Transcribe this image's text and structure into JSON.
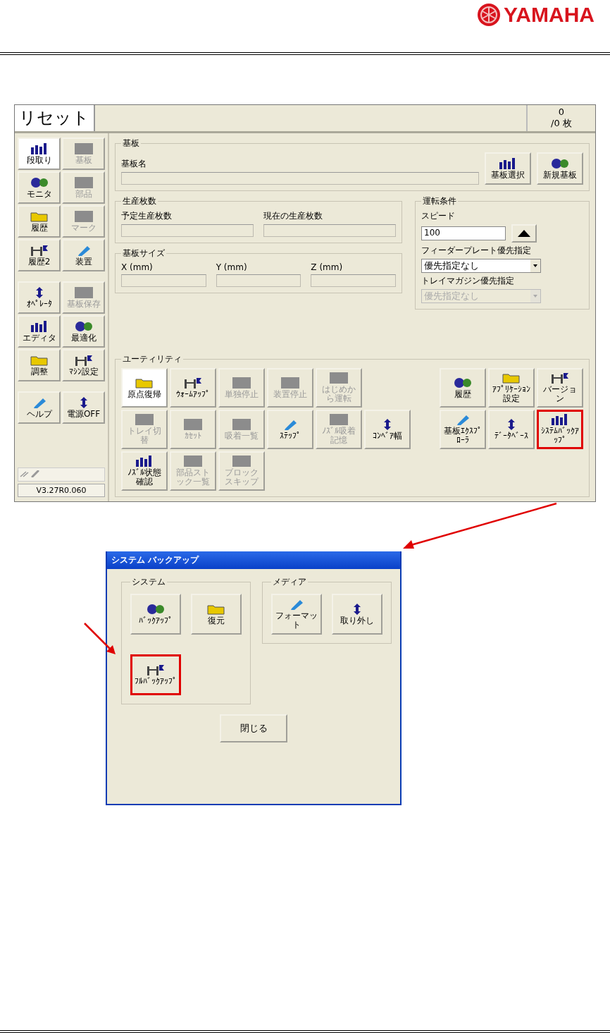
{
  "header": {
    "logo_text": "YAMAHA"
  },
  "main_window": {
    "title": "リセット",
    "count": "0",
    "count_total": "/0 枚",
    "side_groups": [
      [
        {
          "label": "段取り",
          "selected": true,
          "disabled": false
        },
        {
          "label": "基板",
          "selected": false,
          "disabled": true
        },
        {
          "label": "モニタ",
          "selected": false,
          "disabled": false
        },
        {
          "label": "部品",
          "selected": false,
          "disabled": true
        },
        {
          "label": "履歴",
          "selected": false,
          "disabled": false
        },
        {
          "label": "マーク",
          "selected": false,
          "disabled": true
        },
        {
          "label": "履歴2",
          "selected": false,
          "disabled": false
        },
        {
          "label": "装置",
          "selected": false,
          "disabled": false
        }
      ],
      [
        {
          "label": "ｵﾍﾟﾚｰﾀ",
          "selected": false,
          "disabled": false
        },
        {
          "label": "基板保存",
          "selected": false,
          "disabled": true
        },
        {
          "label": "エディタ",
          "selected": false,
          "disabled": false
        },
        {
          "label": "最適化",
          "selected": false,
          "disabled": false
        },
        {
          "label": "調整",
          "selected": false,
          "disabled": false
        },
        {
          "label": "ﾏｼﾝ設定",
          "selected": false,
          "disabled": false
        }
      ],
      [
        {
          "label": "ヘルプ",
          "selected": false,
          "disabled": false
        },
        {
          "label": "電源OFF",
          "selected": false,
          "disabled": false
        }
      ]
    ],
    "version": "V3.27R0.060",
    "board": {
      "title": "基板",
      "name_label": "基板名",
      "buttons": [
        "基板選択",
        "新規基板"
      ]
    },
    "production": {
      "title": "生産枚数",
      "fields": [
        "予定生産枚数",
        "現在の生産枚数"
      ]
    },
    "size": {
      "title": "基板サイズ",
      "fields": [
        "X (mm)",
        "Y (mm)",
        "Z (mm)"
      ]
    },
    "run": {
      "title": "運転条件",
      "speed_label": "スピード",
      "speed": "100",
      "feeder_label": "フィーダープレート優先指定",
      "feeder": {
        "value": "優先指定なし",
        "disabled": false
      },
      "tray_label": "トレイマガジン優先指定",
      "tray": {
        "value": "優先指定なし",
        "disabled": true
      }
    },
    "utility": {
      "title": "ユーティリティ",
      "left_rows": [
        [
          {
            "label": "原点復帰",
            "selected": true,
            "disabled": false,
            "highlighted": false
          },
          {
            "label": "ｳｫｰﾑｱｯﾌﾟ",
            "selected": false,
            "disabled": false,
            "highlighted": false
          },
          {
            "label": "単独停止",
            "selected": false,
            "disabled": true,
            "highlighted": false
          },
          {
            "label": "装置停止",
            "selected": false,
            "disabled": true,
            "highlighted": false
          },
          {
            "label": "はじめから運転",
            "selected": false,
            "disabled": true,
            "highlighted": false
          }
        ],
        [
          {
            "label": "トレイ切替",
            "selected": false,
            "disabled": true,
            "highlighted": false
          },
          {
            "label": "ｶｾｯﾄ",
            "selected": false,
            "disabled": true,
            "highlighted": false
          },
          {
            "label": "吸着一覧",
            "selected": false,
            "disabled": true,
            "highlighted": false
          },
          {
            "label": "ｽﾃｯﾌﾟ",
            "selected": false,
            "disabled": false,
            "highlighted": false
          },
          {
            "label": "ﾉｽﾞﾙ吸着記憶",
            "selected": false,
            "disabled": true,
            "highlighted": false
          },
          {
            "label": "ｺﾝﾍﾞｱ幅",
            "selected": false,
            "disabled": false,
            "highlighted": false
          }
        ],
        [
          {
            "label": "ﾉｽﾞﾙ状態確認",
            "selected": false,
            "disabled": false,
            "highlighted": false
          },
          {
            "label": "部品ストック一覧",
            "selected": false,
            "disabled": true,
            "highlighted": false
          },
          {
            "label": "ブロックスキップ",
            "selected": false,
            "disabled": true,
            "highlighted": false
          }
        ]
      ],
      "right_rows": [
        [
          {
            "label": "履歴",
            "selected": false,
            "disabled": false,
            "highlighted": false
          },
          {
            "label": "ｱﾌﾟﾘｹｰｼｮﾝ設定",
            "selected": false,
            "disabled": false,
            "highlighted": false
          },
          {
            "label": "バージョン",
            "selected": false,
            "disabled": false,
            "highlighted": false
          }
        ],
        [
          {
            "label": "基板ｴｸｽﾌﾟﾛｰﾗ",
            "selected": false,
            "disabled": false,
            "highlighted": false
          },
          {
            "label": "ﾃﾞｰﾀﾍﾞｰｽ",
            "selected": false,
            "disabled": false,
            "highlighted": false
          },
          {
            "label": "ｼｽﾃﾑﾊﾞｯｸｱｯﾌﾟ",
            "selected": false,
            "disabled": false,
            "highlighted": true
          }
        ]
      ]
    }
  },
  "dialog": {
    "title": "システム バックアップ",
    "groups": [
      {
        "title": "システム",
        "buttons": [
          {
            "label": "ﾊﾞｯｸｱｯﾌﾟ",
            "highlighted": false
          },
          {
            "label": "復元",
            "highlighted": false
          },
          {
            "label": "ﾌﾙﾊﾞｯｸｱｯﾌﾟ",
            "highlighted": true
          }
        ]
      },
      {
        "title": "メディア",
        "buttons": [
          {
            "label": "フォーマット",
            "highlighted": false
          },
          {
            "label": "取り外し",
            "highlighted": false
          }
        ]
      }
    ],
    "close": "閉じる"
  }
}
